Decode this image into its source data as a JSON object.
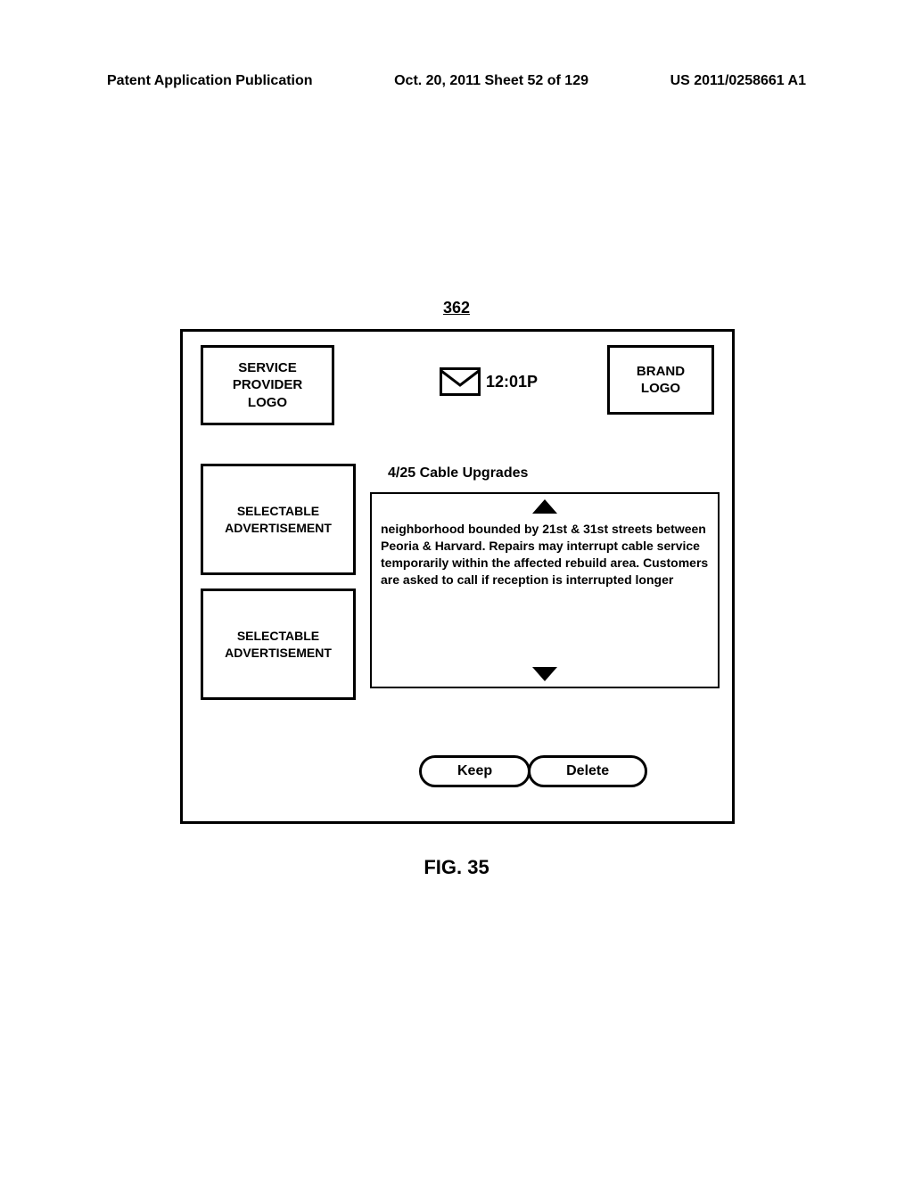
{
  "header": {
    "left": "Patent Application Publication",
    "center": "Oct. 20, 2011  Sheet 52 of 129",
    "right": "US 2011/0258661 A1"
  },
  "reference_number": "362",
  "top": {
    "service_provider_logo": "SERVICE\nPROVIDER\nLOGO",
    "time": "12:01P",
    "brand_logo": "BRAND\nLOGO"
  },
  "ads": {
    "ad1": "SELECTABLE\nADVERTISEMENT",
    "ad2": "SELECTABLE\nADVERTISEMENT"
  },
  "message": {
    "title": "4/25 Cable Upgrades",
    "body": "neighborhood bounded by 21st & 31st streets between Peoria & Harvard.  Repairs may interrupt cable service temporarily within the affected rebuild area.  Customers are asked to call if reception is interrupted longer"
  },
  "buttons": {
    "keep": "Keep",
    "delete": "Delete"
  },
  "figure_caption": "FIG. 35"
}
